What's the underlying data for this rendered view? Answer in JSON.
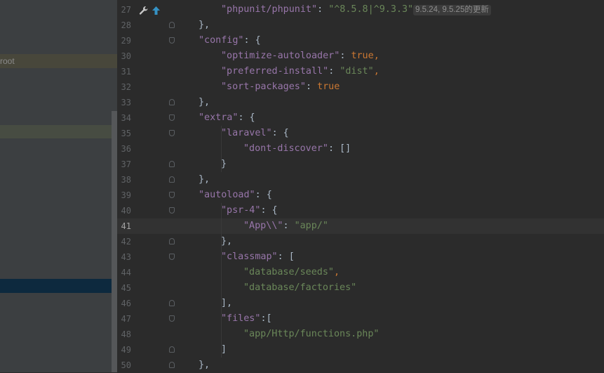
{
  "project_panel": {
    "highlighted_item": "root"
  },
  "gutter_icons": [
    "wrench-icon",
    "arrow-up-icon"
  ],
  "colors": {
    "background": "#2b2b2b",
    "sidebar": "#3c3f41",
    "key": "#9876aa",
    "string": "#6a8759",
    "keyword": "#cc7832",
    "punctuation": "#a9b7c6"
  },
  "editor": {
    "current_line": "41",
    "lines": [
      {
        "n": "27",
        "tokens": [
          {
            "t": "\"phpunit/phpunit\"",
            "c": "k"
          },
          {
            "t": ": ",
            "c": "b"
          },
          {
            "t": "\"^8.5.8|^9.3.3\"",
            "c": "s"
          }
        ],
        "hint": "9.5.24, 9.5.25的更新"
      },
      {
        "n": "28",
        "tokens": [
          {
            "t": "},",
            "c": "b"
          }
        ]
      },
      {
        "n": "29",
        "tokens": [
          {
            "t": "\"config\"",
            "c": "k"
          },
          {
            "t": ": {",
            "c": "b"
          }
        ]
      },
      {
        "n": "30",
        "tokens": [
          {
            "t": "\"optimize-autoloader\"",
            "c": "k"
          },
          {
            "t": ": ",
            "c": "b"
          },
          {
            "t": "true",
            "c": "kw"
          },
          {
            "t": ",",
            "c": "p"
          }
        ]
      },
      {
        "n": "31",
        "tokens": [
          {
            "t": "\"preferred-install\"",
            "c": "k"
          },
          {
            "t": ": ",
            "c": "b"
          },
          {
            "t": "\"dist\"",
            "c": "s"
          },
          {
            "t": ",",
            "c": "p"
          }
        ]
      },
      {
        "n": "32",
        "tokens": [
          {
            "t": "\"sort-packages\"",
            "c": "k"
          },
          {
            "t": ": ",
            "c": "b"
          },
          {
            "t": "true",
            "c": "kw"
          }
        ]
      },
      {
        "n": "33",
        "tokens": [
          {
            "t": "},",
            "c": "b"
          }
        ]
      },
      {
        "n": "34",
        "tokens": [
          {
            "t": "\"extra\"",
            "c": "k"
          },
          {
            "t": ": {",
            "c": "b"
          }
        ]
      },
      {
        "n": "35",
        "tokens": [
          {
            "t": "\"laravel\"",
            "c": "k"
          },
          {
            "t": ": {",
            "c": "b"
          }
        ]
      },
      {
        "n": "36",
        "tokens": [
          {
            "t": "\"dont-discover\"",
            "c": "k"
          },
          {
            "t": ": []",
            "c": "b"
          }
        ]
      },
      {
        "n": "37",
        "tokens": [
          {
            "t": "}",
            "c": "b"
          }
        ]
      },
      {
        "n": "38",
        "tokens": [
          {
            "t": "},",
            "c": "b"
          }
        ]
      },
      {
        "n": "39",
        "tokens": [
          {
            "t": "\"autoload\"",
            "c": "k"
          },
          {
            "t": ": {",
            "c": "b"
          }
        ]
      },
      {
        "n": "40",
        "tokens": [
          {
            "t": "\"psr-4\"",
            "c": "k"
          },
          {
            "t": ": {",
            "c": "b"
          }
        ]
      },
      {
        "n": "41",
        "tokens": [
          {
            "t": "\"App\\\\\"",
            "c": "k"
          },
          {
            "t": ": ",
            "c": "b"
          },
          {
            "t": "\"app/\"",
            "c": "s"
          }
        ]
      },
      {
        "n": "42",
        "tokens": [
          {
            "t": "},",
            "c": "b"
          }
        ]
      },
      {
        "n": "43",
        "tokens": [
          {
            "t": "\"classmap\"",
            "c": "k"
          },
          {
            "t": ": [",
            "c": "b"
          }
        ]
      },
      {
        "n": "44",
        "tokens": [
          {
            "t": "\"database/seeds\"",
            "c": "s"
          },
          {
            "t": ",",
            "c": "p"
          }
        ]
      },
      {
        "n": "45",
        "tokens": [
          {
            "t": "\"database/factories\"",
            "c": "s"
          }
        ]
      },
      {
        "n": "46",
        "tokens": [
          {
            "t": "],",
            "c": "b"
          }
        ]
      },
      {
        "n": "47",
        "tokens": [
          {
            "t": "\"files\"",
            "c": "k"
          },
          {
            "t": ":[",
            "c": "b"
          }
        ]
      },
      {
        "n": "48",
        "tokens": [
          {
            "t": "\"app/Http/functions.php\"",
            "c": "s"
          }
        ]
      },
      {
        "n": "49",
        "tokens": [
          {
            "t": "]",
            "c": "b"
          }
        ]
      },
      {
        "n": "50",
        "tokens": [
          {
            "t": "},",
            "c": "b"
          }
        ]
      }
    ]
  }
}
